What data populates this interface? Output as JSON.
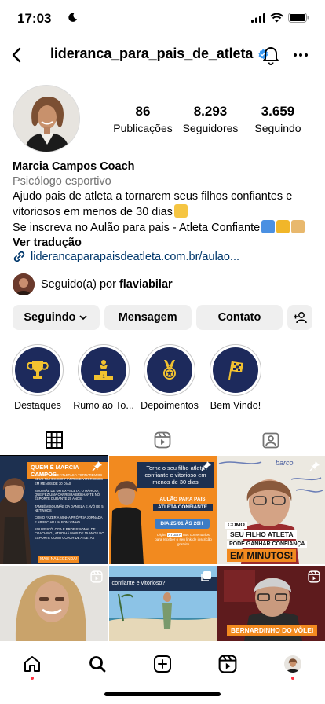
{
  "status": {
    "time": "17:03"
  },
  "header": {
    "username": "lideranca_para_pais_de_atleta"
  },
  "profile": {
    "stats": [
      {
        "number": "86",
        "label": "Publicações"
      },
      {
        "number": "8.293",
        "label": "Seguidores"
      },
      {
        "number": "3.659",
        "label": "Seguindo"
      }
    ],
    "name": "Marcia Campos Coach",
    "category": "Psicólogo esportivo",
    "bio_line1": "Ajudo pais de atleta a tornarem seus filhos confiantes e vitoriosos em menos de 30 dias",
    "bio_line2": "Se inscreva no Aulão para pais - Atleta Confiante",
    "translate": "Ver tradução",
    "link": "liderancaparapaisdeatleta.com.br/aulao...",
    "followed_prefix": "Seguido(a) por ",
    "followed_user": "flaviabilar"
  },
  "buttons": {
    "following": "Seguindo",
    "message": "Mensagem",
    "contact": "Contato"
  },
  "highlights": [
    {
      "label": "Destaques",
      "icon": "trophy-icon"
    },
    {
      "label": "Rumo ao To...",
      "icon": "podium-icon"
    },
    {
      "label": "Depoimentos",
      "icon": "medal-icon"
    },
    {
      "label": "Bem Vindo!",
      "icon": "checkered-flag-icon"
    }
  ],
  "posts": {
    "p1": {
      "title": "QUEM É MARCIA CAMPOS",
      "lines": [
        "AJUDO PAIS DE ATLETAS A TORNAREM OS SEUS FILHOS CONFIANTES E VITORIOSOS EM MENOS DE 30 DIAS",
        "SOU MÃE DE UM EX-ATLETA, O MÁRCIO, QUE FEZ UMA CARREIRA BRILHANTE NO ESPORTE DURANTE 20 ANOS",
        "TAMBÉM SOU MÃE DA DANIELA E AVÓ DE 5 NETINHOS",
        "COMO FAZER A MINHA PRÓPRIA JORNADA E APRECIAR UM BOM VINHO",
        "SOU PSICÓLOGA E PROFISSIONAL DE COACHING , ATUO HÁ MAIS DE 15 ANOS NO ESPORTE COMO COACH DE ATLETAS"
      ],
      "footer": "MAIS NA LEGENDA!"
    },
    "p2": {
      "headline": "Torne o seu filho atleta confiante e vitorioso em menos de 30 dias",
      "sub1": "AULÃO PARA PAIS:",
      "sub2": "ATLETA CONFIANTE",
      "date": "DIA 25/01 ÀS 20H",
      "cta_pre": "Digite ",
      "cta_word": "ATLETA",
      "cta_post": " nos comentários para receber o seu link de inscrição gratuito"
    },
    "p3": {
      "board": "barco",
      "line1": "COMO",
      "line2": "SEU FILHO ATLETA",
      "line3": "PODE GANHAR CONFIANÇA",
      "line4": "EM MINUTOS!"
    },
    "p5": {
      "caption": "confiante e vitorioso?"
    },
    "p6": {
      "caption": "BERNARDINHO DO VÔLEI"
    }
  },
  "colors": {
    "orange": "#f28a1f",
    "navy": "#1d3050",
    "blue_badge": "#3897f0",
    "notif_red": "#ff3040"
  }
}
